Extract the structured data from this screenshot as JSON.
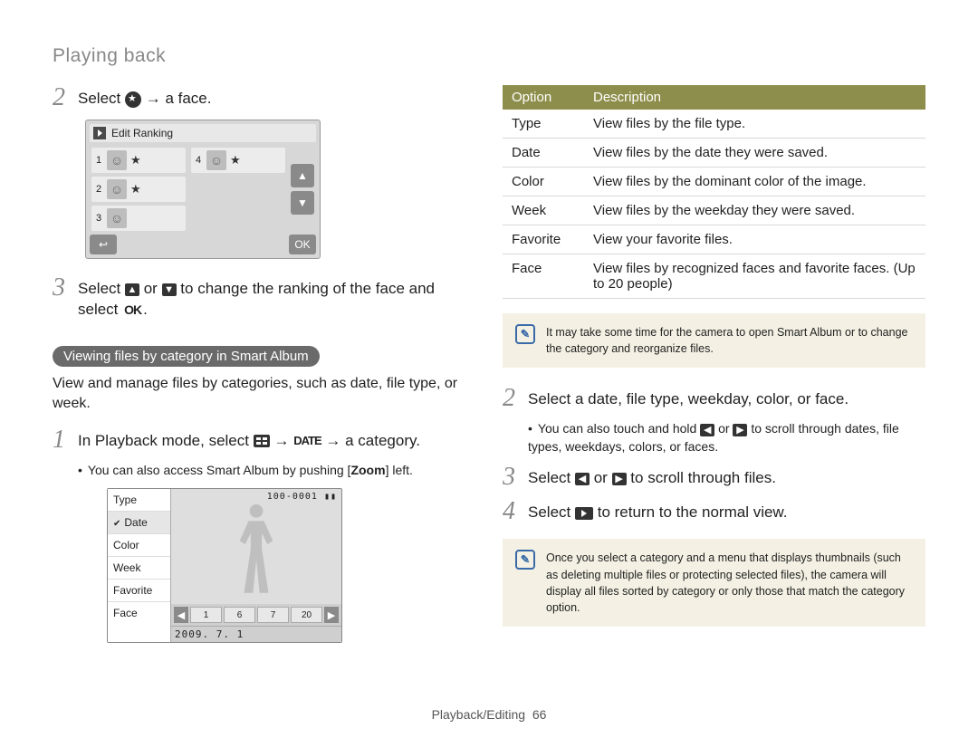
{
  "header": {
    "title": "Playing back"
  },
  "left": {
    "step2": {
      "pre": "Select ",
      "arrow": "→",
      "post": " a face."
    },
    "rank_mock": {
      "title": "Edit Ranking",
      "rows_left": [
        "1",
        "2",
        "3"
      ],
      "rows_right": [
        "4"
      ]
    },
    "step3": {
      "pre": "Select ",
      "mid": " or ",
      "post": " to change the ranking of the face and select ",
      "ok": "OK",
      "period": "."
    },
    "section_pill": "Viewing files by category in Smart Album",
    "section_desc": "View and manage files by categories, such as date, file type, or week.",
    "step1b": {
      "pre": "In Playback mode, select ",
      "arrow": "→",
      "date": "DATE",
      "post": " a category."
    },
    "step1b_sub": "You can also access Smart Album by pushing [",
    "step1b_sub_bold": "Zoom",
    "step1b_sub_end": "] left.",
    "album_mock": {
      "menu": [
        "Type",
        "Date",
        "Color",
        "Week",
        "Favorite",
        "Face"
      ],
      "selected_index": 1,
      "topinfo": "100-0001",
      "thumbs": [
        "1",
        "6",
        "7",
        "20"
      ],
      "date": "2009. 7. 1"
    }
  },
  "right": {
    "table_head": {
      "c1": "Option",
      "c2": "Description"
    },
    "rows": [
      {
        "o": "Type",
        "d": "View files by the file type."
      },
      {
        "o": "Date",
        "d": "View files by the date they were saved."
      },
      {
        "o": "Color",
        "d": "View files by the dominant color of the image."
      },
      {
        "o": "Week",
        "d": "View files by the weekday they were saved."
      },
      {
        "o": "Favorite",
        "d": "View your favorite files."
      },
      {
        "o": "Face",
        "d": "View files by recognized faces and favorite faces. (Up to 20 people)"
      }
    ],
    "note1": "It may take some time for the camera to open Smart Album or to change the category and reorganize files.",
    "step2": "Select a date, file type, weekday, color, or face.",
    "step2_sub_a": "You can also touch and hold ",
    "step2_sub_b": " or ",
    "step2_sub_c": " to scroll through dates, file types, weekdays, colors, or faces.",
    "step3_a": "Select ",
    "step3_b": " or ",
    "step3_c": " to scroll through files.",
    "step4_a": "Select ",
    "step4_b": " to return to the normal view.",
    "note2": "Once you select a category and a menu that displays thumbnails (such as deleting multiple files or protecting selected files), the camera will display all files sorted by category or only those that match the category option."
  },
  "footer": {
    "section": "Playback/Editing",
    "page": "66"
  },
  "glyphs": {
    "up": "▲",
    "down": "▼",
    "left": "◀",
    "right": "▶",
    "back": "↩",
    "ok": "OK"
  }
}
